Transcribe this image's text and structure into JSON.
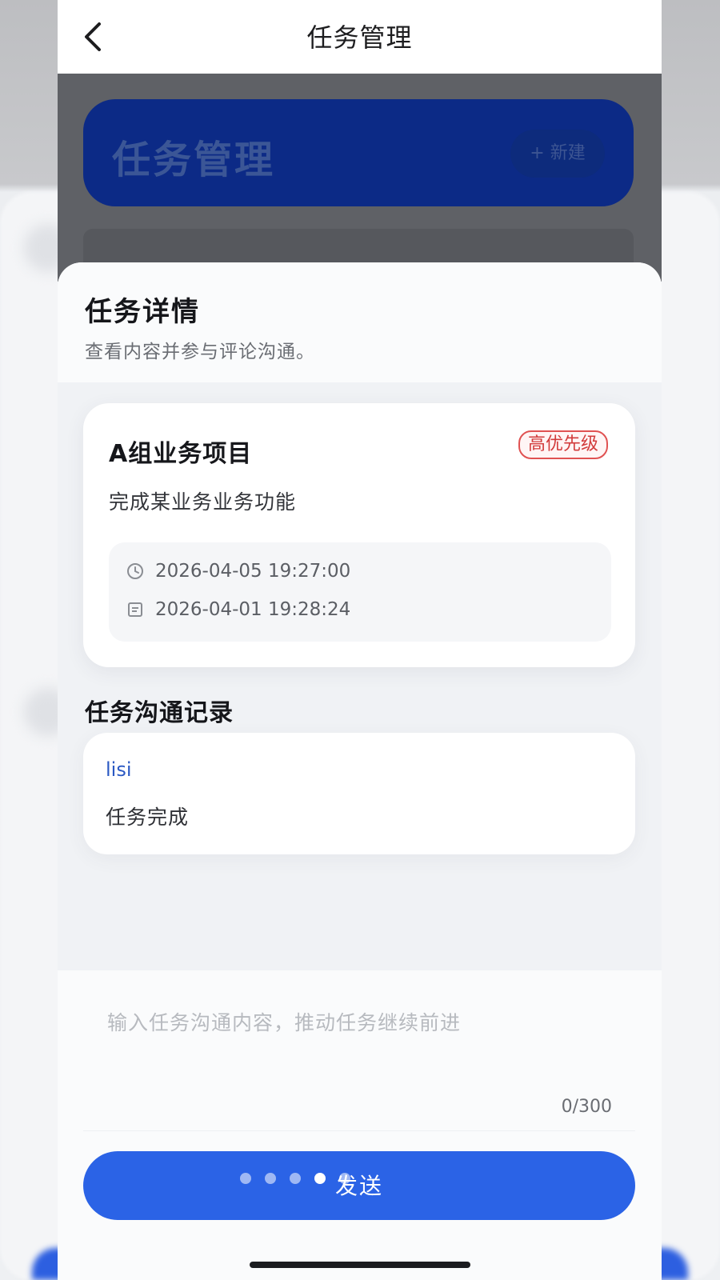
{
  "header": {
    "title": "任务管理"
  },
  "underlay": {
    "banner_title": "任务管理",
    "new_button": "+ 新建"
  },
  "sheet": {
    "title": "任务详情",
    "subtitle": "查看内容并参与评论沟通。"
  },
  "task": {
    "name": "A组业务项目",
    "priority": "高优先级",
    "description": "完成某业务业务功能",
    "deadline": "2026-04-05 19:27:00",
    "created": "2026-04-01 19:28:24"
  },
  "comments": {
    "section_title": "任务沟通记录",
    "items": [
      {
        "user": "lisi",
        "text": "任务完成"
      }
    ]
  },
  "input": {
    "placeholder": "输入任务沟通内容，推动任务继续前进",
    "value": "",
    "char_count": "0/300"
  },
  "send_button": "发送",
  "pager": {
    "count": 5,
    "active_index": 3
  },
  "colors": {
    "primary": "#2b63e6",
    "priority_red": "#d23c3c",
    "username_blue": "#2b59c3"
  }
}
